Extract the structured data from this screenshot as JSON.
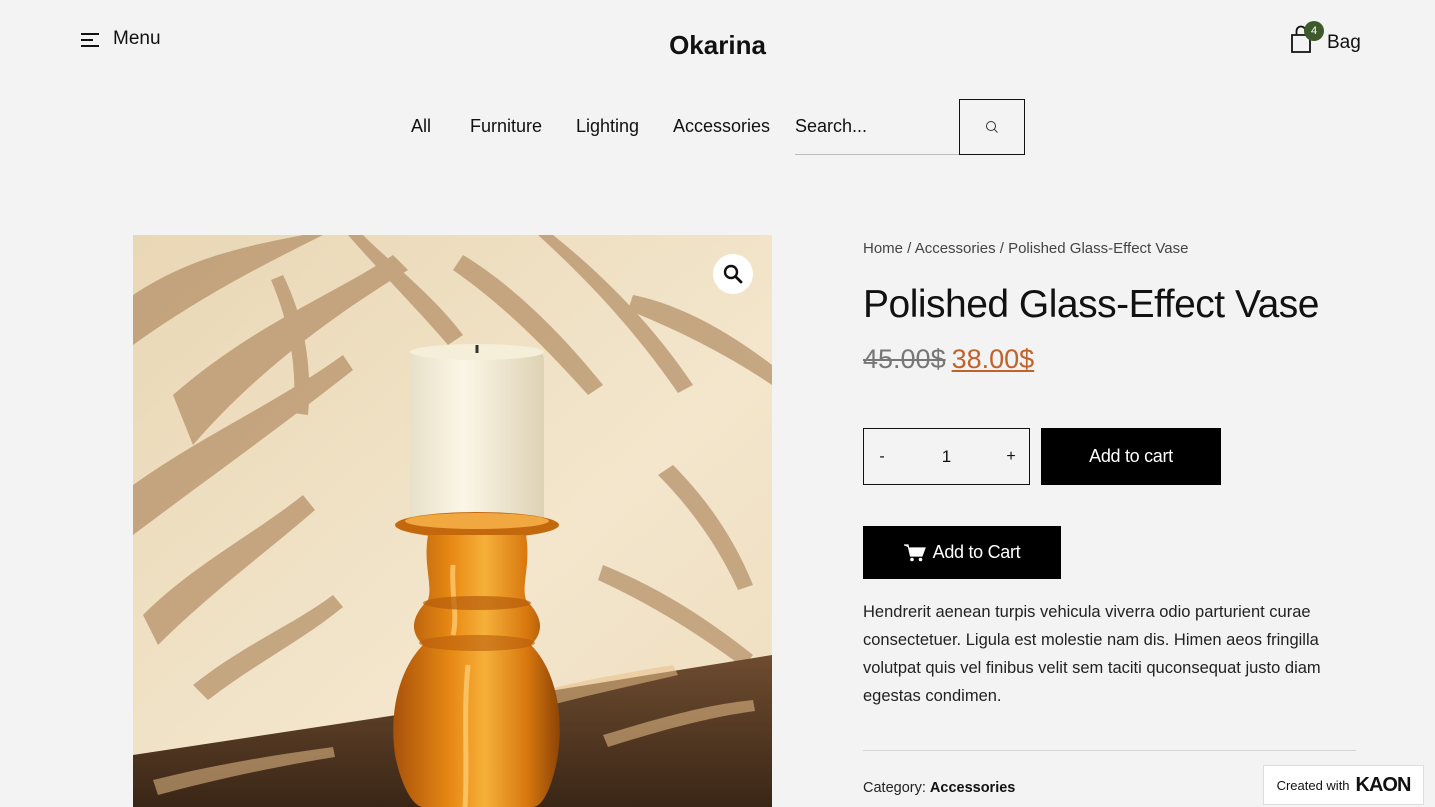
{
  "header": {
    "menu_label": "Menu",
    "logo": "Okarina",
    "bag_label": "Bag",
    "bag_count": "4"
  },
  "nav": {
    "items": [
      "All",
      "Furniture",
      "Lighting",
      "Accessories"
    ],
    "search_placeholder": "Search..."
  },
  "product": {
    "breadcrumb": {
      "home": "Home",
      "category": "Accessories",
      "current": "Polished Glass-Effect Vase",
      "separator": " / "
    },
    "title": "Polished Glass-Effect Vase",
    "old_price": "45.00$",
    "new_price": "38.00$",
    "quantity": "1",
    "qty_minus": "-",
    "qty_plus": "+",
    "add_to_cart_label": "Add to cart",
    "add_to_cart_alt_label": "Add to Cart",
    "description": "Hendrerit aenean turpis vehicula viverra odio parturient curae consectetuer. Ligula est molestie nam dis. Himen aeos fringilla volutpat quis vel finibus velit sem taciti quconsequat justo diam egestas condimen.",
    "category_label": "Category:",
    "category_value": "Accessories"
  },
  "badge": {
    "created_with": "Created with",
    "brand": "KAON"
  },
  "colors": {
    "background": "#f3f3f3",
    "accent_price": "#c0622b",
    "badge_green": "#3d5a2a",
    "button_black": "#000000"
  },
  "icons": [
    "hamburger-icon",
    "bag-icon",
    "search-icon",
    "zoom-icon",
    "cart-icon"
  ]
}
